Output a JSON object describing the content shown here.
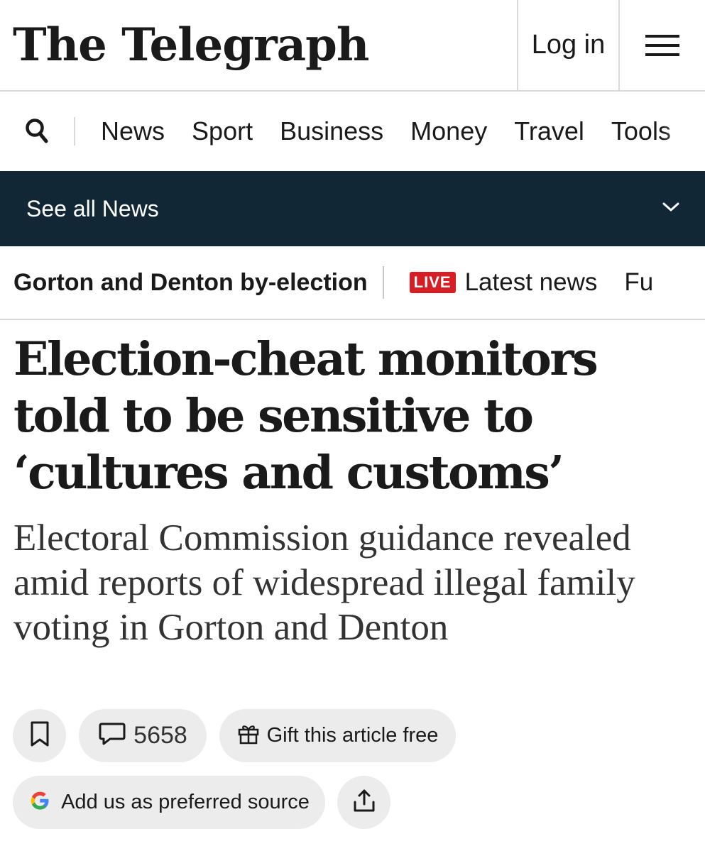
{
  "masthead": {
    "logo_text": "The Telegraph",
    "login_label": "Log in",
    "menu_icon": "hamburger-menu-icon"
  },
  "primary_nav": {
    "search_icon": "search-icon",
    "items": [
      "News",
      "Sport",
      "Business",
      "Money",
      "Travel",
      "Tools"
    ]
  },
  "section_bar": {
    "label": "See all News",
    "toggle_icon": "chevron-down-icon",
    "background": "#122736"
  },
  "topic_strip": {
    "title": "Gorton and Denton by-election",
    "live_badge": "LIVE",
    "live_link": "Latest news",
    "next_link": "Fu",
    "live_color": "#d61e24"
  },
  "article": {
    "headline": "Election-cheat monitors told to be sensitive to ‘cultures and customs’",
    "standfirst": "Electoral Commission guidance revealed amid reports of widespread illegal family voting in Gorton and Denton"
  },
  "actions": {
    "bookmark_icon": "bookmark-icon",
    "comments_icon": "comment-icon",
    "comments_count": "5658",
    "gift_icon": "gift-icon",
    "gift_label": "Gift this article free",
    "google_icon": "google-icon",
    "source_label": "Add us as preferred source",
    "share_icon": "share-icon"
  }
}
